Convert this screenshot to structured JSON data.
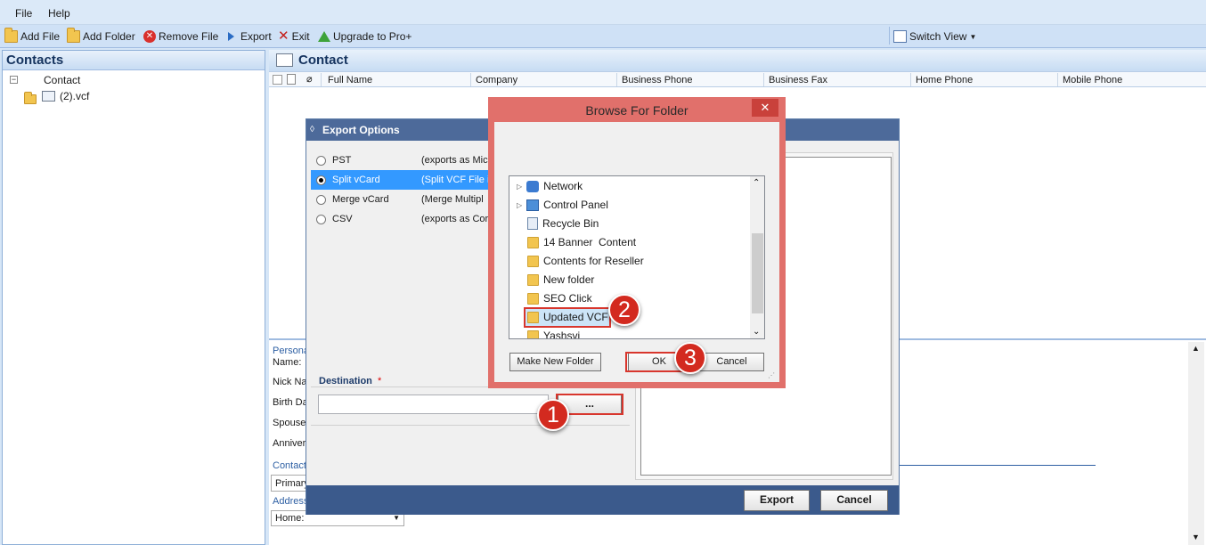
{
  "menu": {
    "file": "File",
    "help": "Help"
  },
  "toolbar": {
    "add_file": "Add File",
    "add_folder": "Add Folder",
    "remove_file": "Remove File",
    "export": "Export",
    "exit": "Exit",
    "upgrade": "Upgrade to Pro+",
    "switch_view": "Switch View"
  },
  "left": {
    "title": "Contacts",
    "tree_root": "Contact",
    "tree_child": "(2).vcf"
  },
  "right": {
    "title": "Contact",
    "columns": [
      "Full Name",
      "Company",
      "Business Phone",
      "Business Fax",
      "Home Phone",
      "Mobile Phone"
    ]
  },
  "detail": {
    "personal": "Persona",
    "name": "Name:",
    "nick": "Nick Nar",
    "birth": "Birth Da",
    "spouse": "Spouse",
    "anniv": "Anniver",
    "contact": "Contact",
    "primary": "Primary",
    "address": "Address",
    "home_sel": "Home:"
  },
  "export_dialog": {
    "title": "Export Options",
    "options": [
      {
        "label": "PST",
        "desc": "(exports as Mic"
      },
      {
        "label": "Split vCard",
        "desc": "(Split VCF File i"
      },
      {
        "label": "Merge vCard",
        "desc": "(Merge Multipl"
      },
      {
        "label": "CSV",
        "desc": "(exports as Cor"
      }
    ],
    "destination_label": "Destination",
    "required_mark": "*",
    "destination_value": "",
    "browse_button": "...",
    "export_button": "Export",
    "cancel_button": "Cancel"
  },
  "browse_dialog": {
    "title": "Browse For Folder",
    "close": "✕",
    "items": [
      "Network",
      "Control Panel",
      "Recycle Bin",
      "14 Banner  Content",
      "Contents for Reseller",
      "New folder",
      "SEO Click",
      "Updated VCF",
      "Yashsvi"
    ],
    "make_new_folder": "Make New Folder",
    "ok": "OK",
    "cancel": "Cancel"
  },
  "annotations": {
    "step1": "1",
    "step2": "2",
    "step3": "3"
  },
  "colors": {
    "accent": "#4d6a9a",
    "highlight": "#d8362d",
    "selection": "#3399ff"
  }
}
